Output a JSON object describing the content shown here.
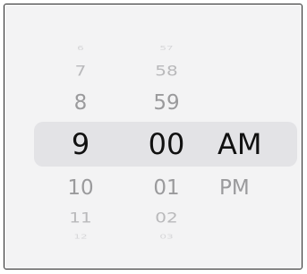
{
  "time_picker": {
    "hours": {
      "above3": "6",
      "above2": "7",
      "above1": "8",
      "selected": "9",
      "below1": "10",
      "below2": "11",
      "below3": "12"
    },
    "minutes": {
      "above3": "57",
      "above2": "58",
      "above1": "59",
      "selected": "00",
      "below1": "01",
      "below2": "02",
      "below3": "03"
    },
    "period": {
      "selected": "AM",
      "below1": "PM"
    }
  }
}
